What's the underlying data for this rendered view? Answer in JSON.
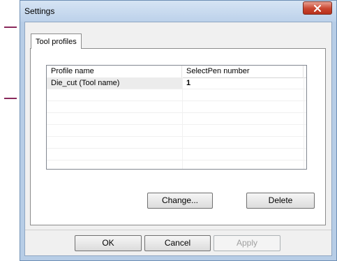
{
  "window": {
    "title": "Settings"
  },
  "tabs": [
    {
      "label": "Tool profiles",
      "selected": true
    }
  ],
  "list": {
    "columns": [
      "Profile name",
      "SelectPen number"
    ],
    "rows": [
      {
        "profile_name": "Die_cut (Tool name)",
        "pen_number": "1"
      }
    ]
  },
  "buttons": {
    "change": "Change...",
    "delete": "Delete",
    "ok": "OK",
    "cancel": "Cancel",
    "apply": "Apply"
  },
  "colors": {
    "close_button": "#c9452f",
    "window_frame": "#b7cde6",
    "background_marks": "#8a2a5c"
  }
}
